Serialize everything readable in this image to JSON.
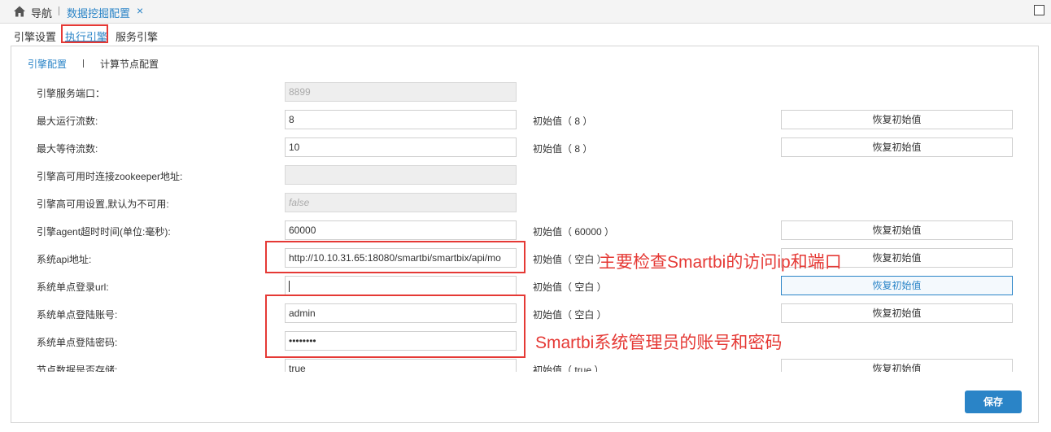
{
  "topbar": {
    "home_icon": "home-icon",
    "nav_label": "导航",
    "tab_title": "数据挖掘配置",
    "close_glyph": "×",
    "maximize_icon": "maximize-icon"
  },
  "engine_tabs": [
    {
      "label": "引擎设置",
      "active": false
    },
    {
      "label": "执行引擎",
      "active": true
    },
    {
      "label": "服务引擎",
      "active": false
    }
  ],
  "sub_tabs": [
    {
      "label": "引擎配置",
      "active": true
    },
    {
      "label": "计算节点配置",
      "active": false
    }
  ],
  "form": {
    "rows": [
      {
        "label": "引擎服务端口：",
        "value": "8899",
        "disabled": true,
        "initial": "",
        "reset": ""
      },
      {
        "label": "最大运行流数:",
        "value": "8",
        "disabled": false,
        "initial": "初始值（ 8 ）",
        "reset": "恢复初始值"
      },
      {
        "label": "最大等待流数:",
        "value": "10",
        "disabled": false,
        "initial": "初始值（ 8 ）",
        "reset": "恢复初始值"
      },
      {
        "label": "引擎高可用时连接zookeeper地址:",
        "value": "",
        "disabled": true,
        "initial": "",
        "reset": ""
      },
      {
        "label": "引擎高可用设置,默认为不可用:",
        "value": "false",
        "disabled": true,
        "initial": "",
        "reset": ""
      },
      {
        "label": "引擎agent超时时间(单位:毫秒):",
        "value": "60000",
        "disabled": false,
        "initial": "初始值（ 60000 ）",
        "reset": "恢复初始值"
      },
      {
        "label": "系统api地址:",
        "value": "http://10.10.31.65:18080/smartbi/smartbix/api/mo",
        "disabled": false,
        "initial": "初始值（ 空白 ）",
        "reset": "恢复初始值"
      },
      {
        "label": "系统单点登录url:",
        "value": "",
        "disabled": false,
        "focused": true,
        "initial": "初始值（ 空白 ）",
        "reset": "恢复初始值",
        "reset_hover": true
      },
      {
        "label": "系统单点登陆账号:",
        "value": "admin",
        "disabled": false,
        "initial": "初始值（ 空白 ）",
        "reset": "恢复初始值"
      },
      {
        "label": "系统单点登陆密码:",
        "value": "••••••••",
        "disabled": false,
        "initial": "",
        "reset": ""
      },
      {
        "label": "节点数据是否存储:",
        "value": "true",
        "disabled": false,
        "initial": "初始值（ true ）",
        "reset": "恢复初始值"
      }
    ],
    "save_label": "保存"
  },
  "annotations": {
    "api_note": "主要检查Smartbi的访问ip和端口",
    "account_note": "Smartbi系统管理员的账号和密码",
    "color": "#e53935"
  },
  "colors": {
    "accent": "#2a84c7",
    "annotation": "#e53935"
  }
}
